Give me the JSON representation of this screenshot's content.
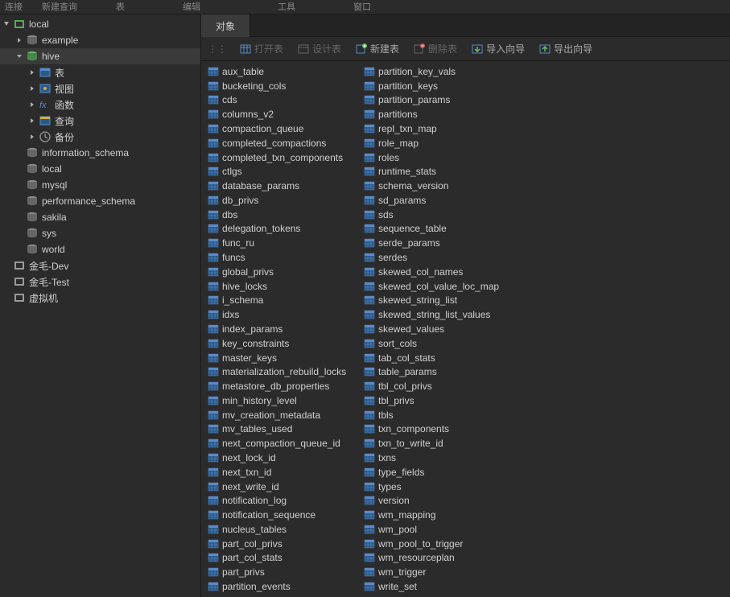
{
  "menubar": [
    "连接",
    "新建查询",
    "",
    "表",
    "",
    "",
    "编辑",
    "",
    "",
    "",
    "工具",
    "",
    "",
    "窗口"
  ],
  "sidebar": {
    "root": {
      "label": "local",
      "expanded": true
    },
    "databases": [
      {
        "label": "example",
        "expanded": false,
        "active": false,
        "children": []
      },
      {
        "label": "hive",
        "expanded": true,
        "active": true,
        "children": [
          {
            "label": "表",
            "type": "tables"
          },
          {
            "label": "视图",
            "type": "views"
          },
          {
            "label": "函数",
            "type": "functions"
          },
          {
            "label": "查询",
            "type": "queries"
          },
          {
            "label": "备份",
            "type": "backup"
          }
        ]
      },
      {
        "label": "information_schema",
        "expanded": false,
        "active": false
      },
      {
        "label": "local",
        "expanded": false,
        "active": false
      },
      {
        "label": "mysql",
        "expanded": false,
        "active": false
      },
      {
        "label": "performance_schema",
        "expanded": false,
        "active": false
      },
      {
        "label": "sakila",
        "expanded": false,
        "active": false
      },
      {
        "label": "sys",
        "expanded": false,
        "active": false
      },
      {
        "label": "world",
        "expanded": false,
        "active": false
      }
    ],
    "connections": [
      {
        "label": "金毛-Dev"
      },
      {
        "label": "金毛-Test"
      },
      {
        "label": "虚拟机"
      }
    ]
  },
  "tab": {
    "label": "对象"
  },
  "toolbar": {
    "open": "打开表",
    "design": "设计表",
    "new": "新建表",
    "delete": "删除表",
    "import": "导入向导",
    "export": "导出向导"
  },
  "tables": {
    "col1": [
      "aux_table",
      "bucketing_cols",
      "cds",
      "columns_v2",
      "compaction_queue",
      "completed_compactions",
      "completed_txn_components",
      "ctlgs",
      "database_params",
      "db_privs",
      "dbs",
      "delegation_tokens",
      "func_ru",
      "funcs",
      "global_privs",
      "hive_locks",
      "i_schema",
      "idxs",
      "index_params",
      "key_constraints",
      "master_keys",
      "materialization_rebuild_locks",
      "metastore_db_properties",
      "min_history_level",
      "mv_creation_metadata",
      "mv_tables_used",
      "next_compaction_queue_id",
      "next_lock_id",
      "next_txn_id",
      "next_write_id",
      "notification_log",
      "notification_sequence",
      "nucleus_tables",
      "part_col_privs",
      "part_col_stats",
      "part_privs",
      "partition_events"
    ],
    "col2": [
      "partition_key_vals",
      "partition_keys",
      "partition_params",
      "partitions",
      "repl_txn_map",
      "role_map",
      "roles",
      "runtime_stats",
      "schema_version",
      "sd_params",
      "sds",
      "sequence_table",
      "serde_params",
      "serdes",
      "skewed_col_names",
      "skewed_col_value_loc_map",
      "skewed_string_list",
      "skewed_string_list_values",
      "skewed_values",
      "sort_cols",
      "tab_col_stats",
      "table_params",
      "tbl_col_privs",
      "tbl_privs",
      "tbls",
      "txn_components",
      "txn_to_write_id",
      "txns",
      "type_fields",
      "types",
      "version",
      "wm_mapping",
      "wm_pool",
      "wm_pool_to_trigger",
      "wm_resourceplan",
      "wm_trigger",
      "write_set"
    ]
  }
}
